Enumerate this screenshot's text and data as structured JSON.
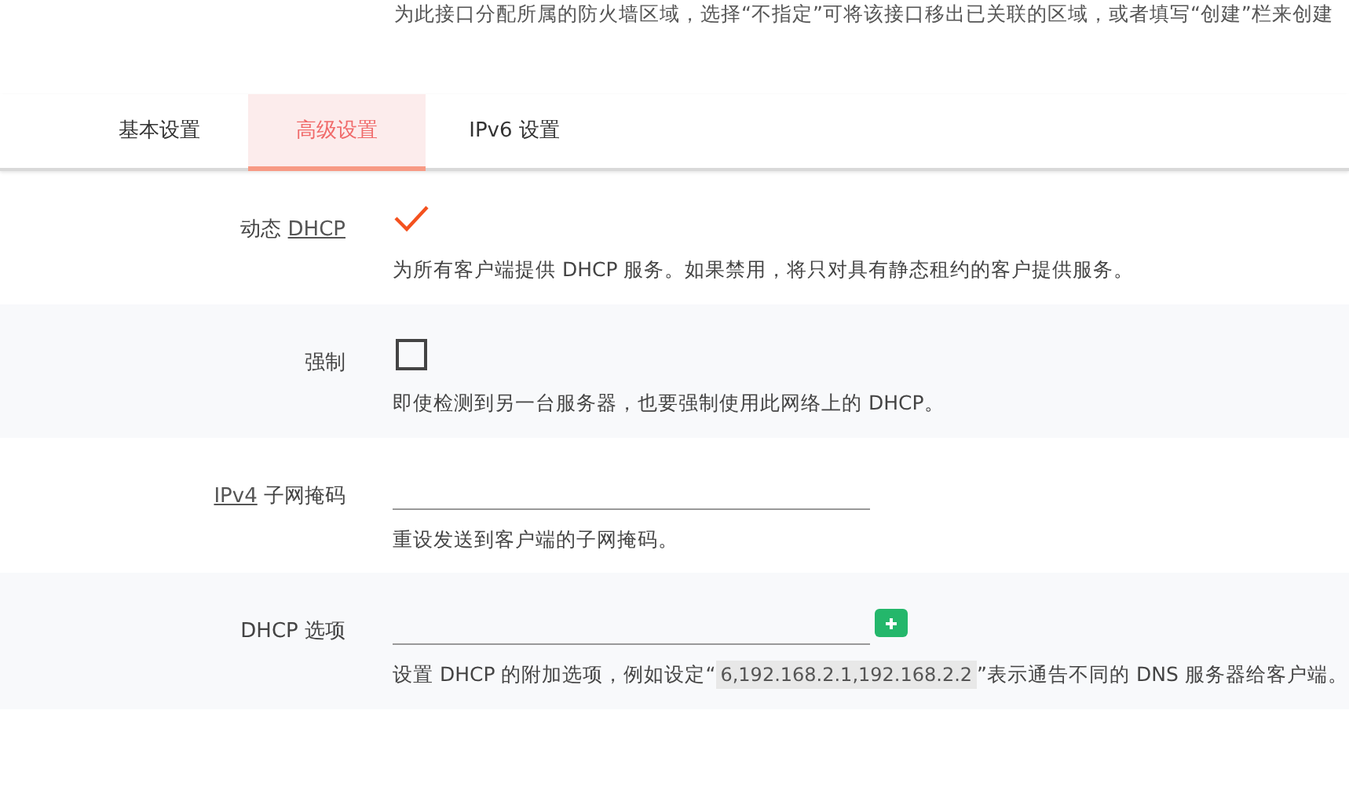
{
  "top_description": "为此接口分配所属的防火墙区域，选择“不指定”可将该接口移出已关联的区域，或者填写“创建”栏来创建",
  "tabs": [
    {
      "label": "基本设置",
      "selected": false
    },
    {
      "label": "高级设置",
      "selected": true
    },
    {
      "label": "IPv6 设置",
      "selected": false
    }
  ],
  "options": [
    {
      "kind": "checkbox",
      "label": [
        {
          "text": "动态 ",
          "abbr": false
        },
        {
          "text": "DHCP",
          "abbr": true
        }
      ],
      "checked": true,
      "description": [
        {
          "text": "为所有客户端提供 DHCP 服务。如果禁用，将只对具有静态租约的客户提供服务。",
          "code": false
        }
      ]
    },
    {
      "kind": "checkbox",
      "label": [
        {
          "text": "强制",
          "abbr": false
        }
      ],
      "checked": false,
      "description": [
        {
          "text": "即使检测到另一台服务器，也要强制使用此网络上的 DHCP。",
          "code": false
        }
      ]
    },
    {
      "kind": "text",
      "label": [
        {
          "text": "IPv4",
          "abbr": true
        },
        {
          "text": " 子网掩码",
          "abbr": false
        }
      ],
      "description": [
        {
          "text": "重设发送到客户端的子网掩码。",
          "code": false
        }
      ]
    },
    {
      "kind": "list",
      "label": [
        {
          "text": "DHCP 选项",
          "abbr": false
        }
      ],
      "description": [
        {
          "text": "设置 DHCP 的附加选项，例如设定“",
          "code": false
        },
        {
          "text": "6,192.168.2.1,192.168.2.2",
          "code": true
        },
        {
          "text": "”表示通告不同的 DNS 服务器给客户端。",
          "code": false
        }
      ]
    }
  ]
}
